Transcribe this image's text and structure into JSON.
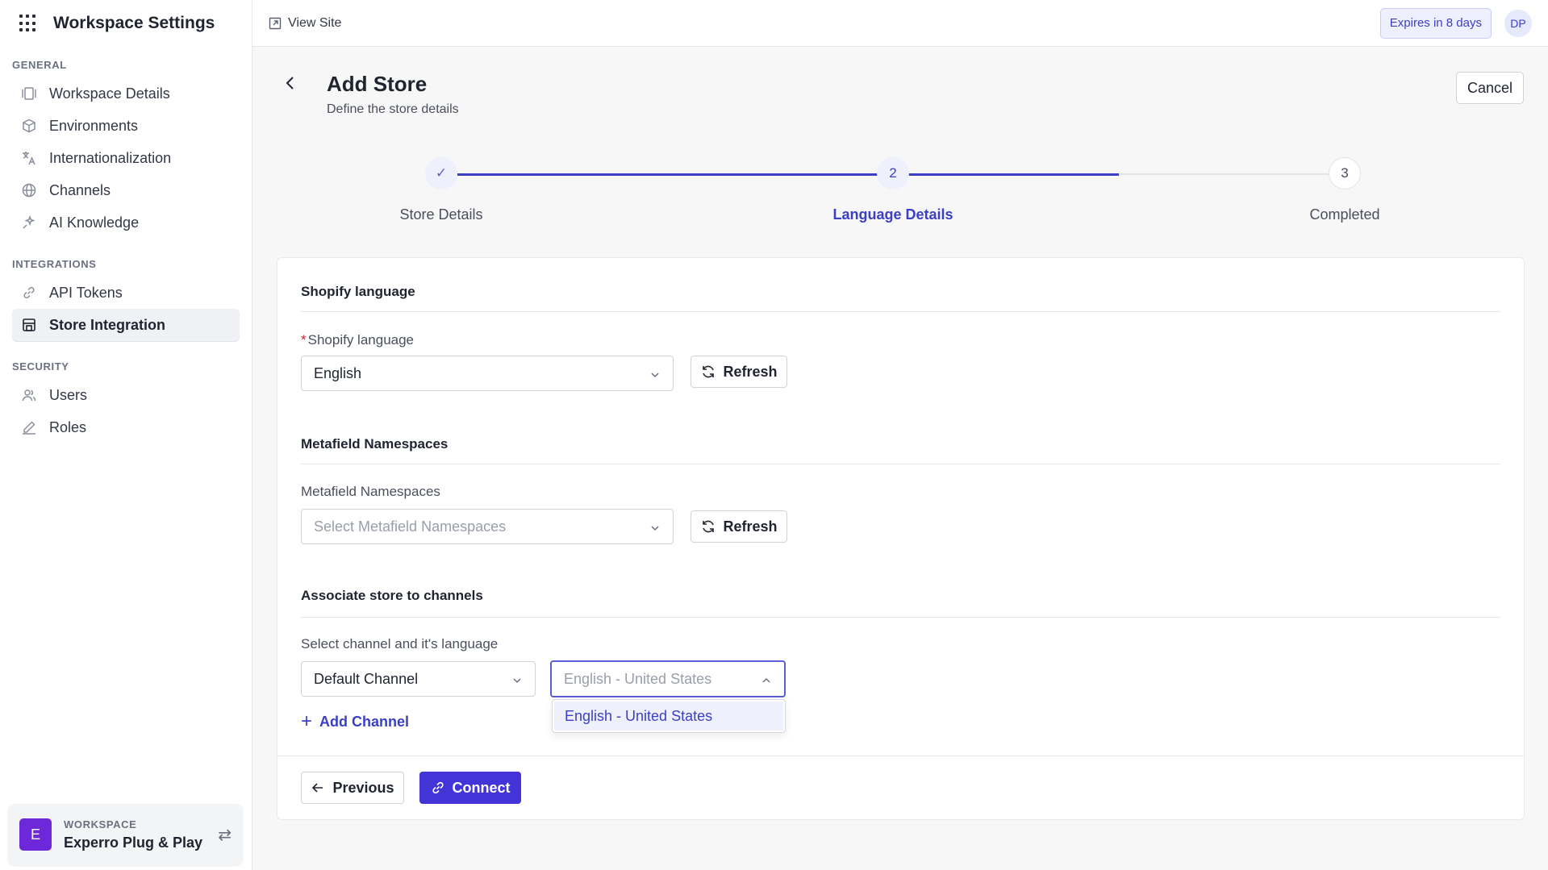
{
  "sidebar": {
    "title": "Workspace Settings",
    "sections": [
      {
        "label": "GENERAL",
        "items": [
          {
            "label": "Workspace Details",
            "icon": "panel-icon"
          },
          {
            "label": "Environments",
            "icon": "cube-icon"
          },
          {
            "label": "Internationalization",
            "icon": "translate-icon"
          },
          {
            "label": "Channels",
            "icon": "globe-icon"
          },
          {
            "label": "AI Knowledge",
            "icon": "sparkle-icon"
          }
        ]
      },
      {
        "label": "INTEGRATIONS",
        "items": [
          {
            "label": "API Tokens",
            "icon": "link-icon"
          },
          {
            "label": "Store Integration",
            "icon": "store-icon",
            "active": true
          }
        ]
      },
      {
        "label": "SECURITY",
        "items": [
          {
            "label": "Users",
            "icon": "users-icon"
          },
          {
            "label": "Roles",
            "icon": "pen-icon"
          }
        ]
      }
    ],
    "workspace": {
      "label": "WORKSPACE",
      "name": "Experro Plug & Play",
      "avatar_letter": "E"
    }
  },
  "topbar": {
    "view_site": "View Site",
    "expires": "Expires in 8 days",
    "avatar_initials": "DP"
  },
  "page": {
    "title": "Add Store",
    "subtitle": "Define the store details",
    "cancel": "Cancel"
  },
  "stepper": {
    "steps": [
      {
        "label": "Store Details",
        "marker": "✓",
        "state": "done"
      },
      {
        "label": "Language Details",
        "marker": "2",
        "state": "active"
      },
      {
        "label": "Completed",
        "marker": "3",
        "state": "pending"
      }
    ],
    "progress_fraction": 0.75
  },
  "form": {
    "shopify_section": "Shopify language",
    "shopify_label": "Shopify language",
    "shopify_value": "English",
    "refresh_label": "Refresh",
    "metafield_section": "Metafield Namespaces",
    "metafield_label": "Metafield Namespaces",
    "metafield_placeholder": "Select Metafield Namespaces",
    "channels_section": "Associate store to channels",
    "channels_label": "Select channel and it's language",
    "channel_value": "Default Channel",
    "language_placeholder": "English - United States",
    "dropdown_options": [
      "English - United States"
    ],
    "add_channel": "Add Channel",
    "previous": "Previous",
    "connect": "Connect"
  },
  "colors": {
    "accent": "#3b3fc4",
    "primary_button": "#4334d8",
    "workspace_avatar": "#6d28d9",
    "required": "#d21f2b"
  }
}
